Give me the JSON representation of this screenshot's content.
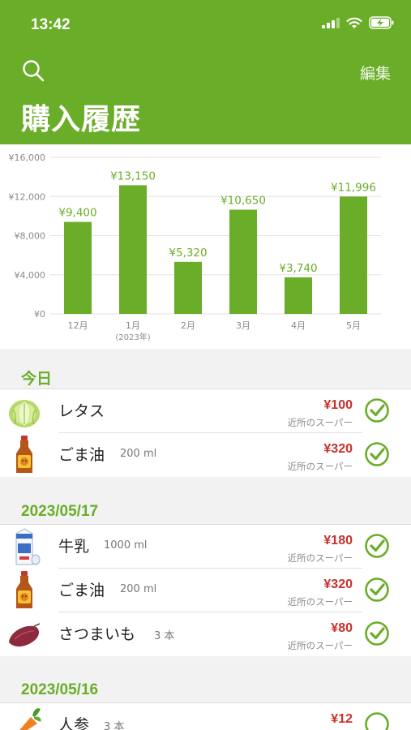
{
  "status_bar": {
    "time": "13:42"
  },
  "header": {
    "edit_label": "編集",
    "title": "購入履歴",
    "search_icon": "search-icon"
  },
  "colors": {
    "brand_green": "#6aad28",
    "price_red": "#c8302c"
  },
  "chart_data": {
    "type": "bar",
    "categories": [
      "12月",
      "1月",
      "2月",
      "3月",
      "4月",
      "5月"
    ],
    "sub_labels": [
      "",
      "(2023年)",
      "",
      "",
      "",
      ""
    ],
    "values": [
      9400,
      13150,
      5320,
      10650,
      3740,
      11996
    ],
    "value_labels": [
      "¥9,400",
      "¥13,150",
      "¥5,320",
      "¥10,650",
      "¥3,740",
      "¥11,996"
    ],
    "yticks": [
      0,
      4000,
      8000,
      12000,
      16000
    ],
    "ytick_labels": [
      "¥0",
      "¥4,000",
      "¥8,000",
      "¥12,000",
      "¥16,000"
    ],
    "ylim": [
      0,
      16000
    ],
    "grid": true,
    "bar_color": "#6aad28"
  },
  "sections": [
    {
      "title": "今日",
      "items": [
        {
          "name": "レタス",
          "qty": "",
          "price": "¥100",
          "store": "近所のスーパー",
          "checked": true,
          "icon": "lettuce-icon"
        },
        {
          "name": "ごま油",
          "qty": "200 ml",
          "price": "¥320",
          "store": "近所のスーパー",
          "checked": true,
          "icon": "sesame-oil-icon"
        }
      ]
    },
    {
      "title": "2023/05/17",
      "items": [
        {
          "name": "牛乳",
          "qty": "1000 ml",
          "price": "¥180",
          "store": "近所のスーパー",
          "checked": true,
          "icon": "milk-carton-icon"
        },
        {
          "name": "ごま油",
          "qty": "200 ml",
          "price": "¥320",
          "store": "近所のスーパー",
          "checked": true,
          "icon": "sesame-oil-icon"
        },
        {
          "name": "さつまいも",
          "qty": "3 本",
          "price": "¥80",
          "store": "近所のスーパー",
          "checked": true,
          "icon": "sweet-potato-icon"
        }
      ]
    },
    {
      "title": "2023/05/16",
      "items": [
        {
          "name": "人参",
          "qty": "3 本",
          "price": "¥12",
          "store": "",
          "checked": false,
          "icon": "carrot-icon"
        }
      ]
    }
  ]
}
